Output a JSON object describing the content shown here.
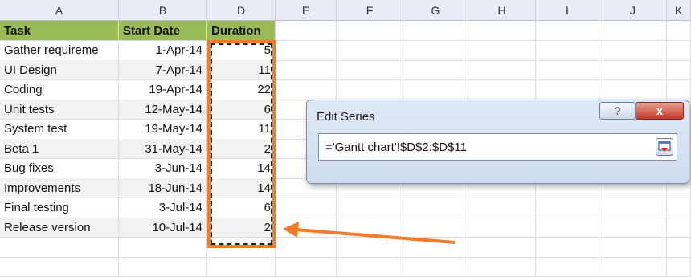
{
  "columns": [
    "A",
    "B",
    "D",
    "E",
    "F",
    "G",
    "H",
    "I",
    "J",
    "K"
  ],
  "table": {
    "headers": [
      "Task",
      "Start Date",
      "Duration"
    ],
    "rows": [
      [
        "Gather requireme",
        "1-Apr-14",
        "5"
      ],
      [
        "UI Design",
        "7-Apr-14",
        "11"
      ],
      [
        "Coding",
        "19-Apr-14",
        "22"
      ],
      [
        "Unit tests",
        "12-May-14",
        "6"
      ],
      [
        "System test",
        "19-May-14",
        "11"
      ],
      [
        "Beta 1",
        "31-May-14",
        "2"
      ],
      [
        "Bug fixes",
        "3-Jun-14",
        "14"
      ],
      [
        "Improvements",
        "18-Jun-14",
        "14"
      ],
      [
        "Final testing",
        "3-Jul-14",
        "6"
      ],
      [
        "Release version",
        "10-Jul-14",
        "2"
      ]
    ]
  },
  "dialog": {
    "title": "Edit Series",
    "help_label": "?",
    "close_label": "x",
    "reference_value": "='Gantt chart'!$D$2:$D$11"
  },
  "colors": {
    "header_fill": "#9bbb59",
    "highlight": "#f47b2a"
  }
}
